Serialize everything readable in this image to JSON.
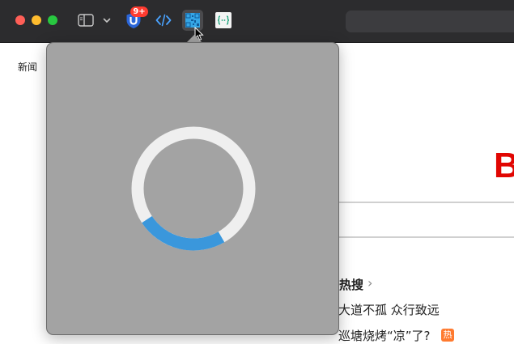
{
  "toolbar": {
    "extension_badge": "9+"
  },
  "page": {
    "nav_link": "新闻",
    "logo_letter": "B",
    "hot_search": {
      "title": "热搜",
      "arrow": "›",
      "items": [
        "大道不孤 众行致远",
        "巡塘烧烤“凉”了?"
      ],
      "tag": "热"
    }
  },
  "popover": {
    "loading_progress": 0.24
  },
  "colors": {
    "toolbar": "#2c2c2e",
    "popover": "#a3a3a3",
    "spinner_track": "#efefef",
    "spinner_progress": "#3a97dc",
    "badge": "#ff3b30",
    "logo": "#e10602"
  },
  "icons": [
    "sidebar-toggle-icon",
    "chevron-down-icon",
    "shield-extension-icon",
    "code-extension-icon",
    "qr-code-extension-icon",
    "json-extension-icon",
    "mouse-cursor-icon",
    "loading-spinner"
  ]
}
